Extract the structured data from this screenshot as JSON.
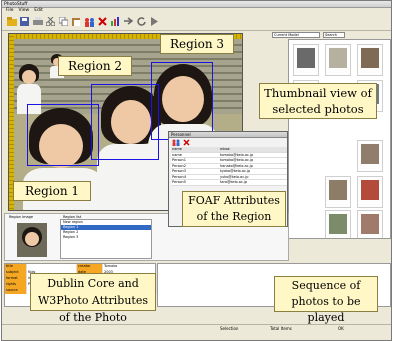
{
  "window": {
    "title": "PhotoStuff"
  },
  "menu": [
    "File",
    "View",
    "Edit"
  ],
  "toolbar": {
    "icons": [
      "open-folder-icon",
      "save-icon",
      "print-icon",
      "scissors-icon",
      "copy-icon",
      "paste-icon",
      "people-icon",
      "delete-icon",
      "chart-icon",
      "forward-icon",
      "refresh-icon",
      "play-icon"
    ]
  },
  "thumbnail_bar": {
    "selector_value": "Current Model",
    "search_value": "Search"
  },
  "callouts": {
    "region1": "Region 1",
    "region2": "Region 2",
    "region3": "Region 3",
    "thumbnails": "Thumbnail view of selected photos",
    "foaf": "FOAF Attributes of the Region",
    "dublin": "Dublin Core and W3Photo Attributes of the Photo",
    "sequence": "Sequence of photos to be played"
  },
  "foaf_window": {
    "title": "Personnel",
    "columns": [
      "name",
      "mbox"
    ],
    "rows": [
      [
        "name",
        "tomoko@keio.ac.jp"
      ],
      [
        "Person1",
        "tomoko@keio.ac.jp"
      ],
      [
        "Person2",
        "hanako@keio.ac.jp"
      ],
      [
        "Person3",
        "kyoko@keio.ac.jp"
      ],
      [
        "Person4",
        "yuko@keio.ac.jp"
      ],
      [
        "Person5",
        "taro@keio.ac.jp"
      ]
    ]
  },
  "region_panel": {
    "header_left": "Region Image",
    "header_right": "Region list",
    "items": [
      "New region",
      "Region 1",
      "Region 2",
      "Region 3"
    ]
  },
  "dc_table": {
    "rows": [
      [
        "title",
        "",
        "creator",
        "Tomoko"
      ],
      [
        "subject",
        "Kids",
        "date",
        "2003"
      ],
      [
        "format",
        "image/jpeg",
        "description",
        ""
      ],
      [
        "rights",
        "Public",
        "identifier",
        "photo.jpg"
      ],
      [
        "source",
        "",
        "type",
        "Image"
      ]
    ]
  },
  "status_bar": {
    "selection": "Selection",
    "total": "Total Items",
    "value": "OK"
  }
}
